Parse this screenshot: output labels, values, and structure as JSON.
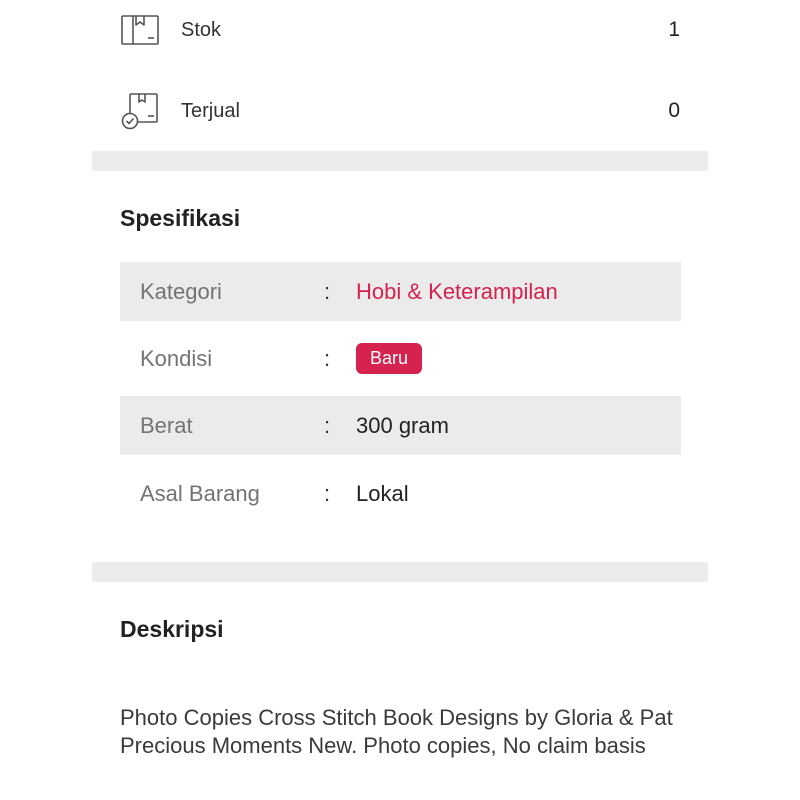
{
  "stock": {
    "stok_label": "Stok",
    "stok_value": "1",
    "terjual_label": "Terjual",
    "terjual_value": "0"
  },
  "specifications": {
    "title": "Spesifikasi",
    "separator": ":",
    "rows": [
      {
        "label": "Kategori",
        "value": "Hobi & Keterampilan"
      },
      {
        "label": "Kondisi",
        "value": "Baru"
      },
      {
        "label": "Berat",
        "value": "300 gram"
      },
      {
        "label": "Asal Barang",
        "value": "Lokal"
      }
    ]
  },
  "description": {
    "title": "Deskripsi",
    "text": "Photo Copies Cross Stitch Book Designs by Gloria & Pat Precious Moments New. Photo copies, No claim basis"
  },
  "colors": {
    "accent": "#d5224f",
    "divider": "#ececec",
    "row_shade": "#ebebeb"
  },
  "icons": {
    "stok": "box-stock-icon",
    "terjual": "box-sold-check-icon"
  }
}
